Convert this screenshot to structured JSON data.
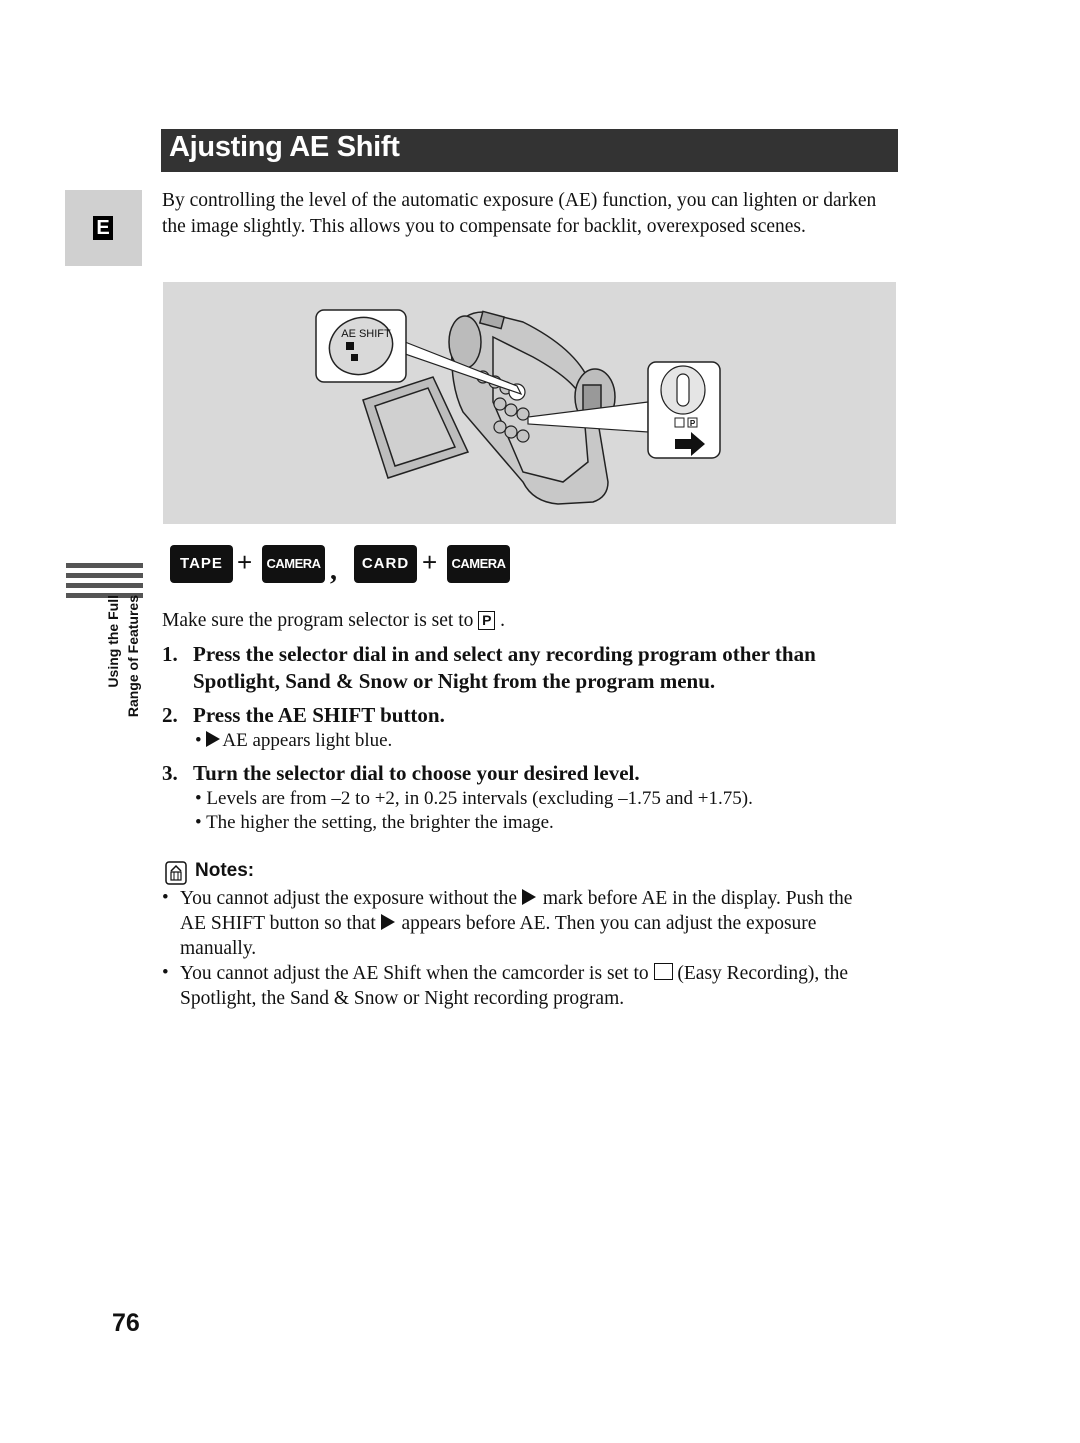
{
  "header": {
    "title": "Ajusting AE Shift"
  },
  "language_tab": {
    "letter": "E"
  },
  "intro": "By controlling the level of the automatic exposure (AE) function, you can lighten or darken the image slightly. This allows you to compensate for backlit, overexposed scenes.",
  "figure": {
    "callout_left_label": "AE SHIFT",
    "callout_right_labels": [
      "P"
    ],
    "background_color": "#d9d9d9"
  },
  "modes": [
    {
      "label": "TAPE",
      "joiner": "+"
    },
    {
      "label": "CAMERA",
      "joiner": ","
    },
    {
      "label": "CARD",
      "joiner": "+"
    },
    {
      "label": "CAMERA",
      "joiner": ""
    }
  ],
  "side_label": {
    "line1": "Using the Full",
    "line2": "Range of Features"
  },
  "precondition": {
    "text": "Make sure the program selector is set to",
    "symbol": "P",
    "end": "."
  },
  "steps": [
    {
      "num": "1.",
      "text": "Press the selector dial in and select any recording program other than Spotlight, Sand & Snow or Night from the program menu.",
      "bullets": []
    },
    {
      "num": "2.",
      "text": "Press the AE SHIFT button.",
      "bullets": [
        "AE appears light blue."
      ]
    },
    {
      "num": "3.",
      "text": "Turn the selector dial to choose your desired level.",
      "bullets": [
        "Levels are from –2 to +2, in 0.25 intervals (excluding –1.75 and +1.75).",
        "The higher the setting, the brighter the image."
      ]
    }
  ],
  "notes": {
    "heading": "Notes:",
    "items": [
      {
        "a": "You cannot adjust the exposure without the",
        "b": "mark before AE in the display. Push the AE SHIFT button so that",
        "c": "appears before AE. Then you can adjust the exposure manually."
      },
      {
        "a": "You cannot adjust the AE Shift when the camcorder is set to",
        "b": "(Easy Recording), the Spotlight, the Sand & Snow or Night recording program."
      }
    ]
  },
  "page_number": "76",
  "colors": {
    "title_bar": "#333333",
    "tab_bg": "#d0d0d0",
    "mode_badge": "#111111"
  }
}
